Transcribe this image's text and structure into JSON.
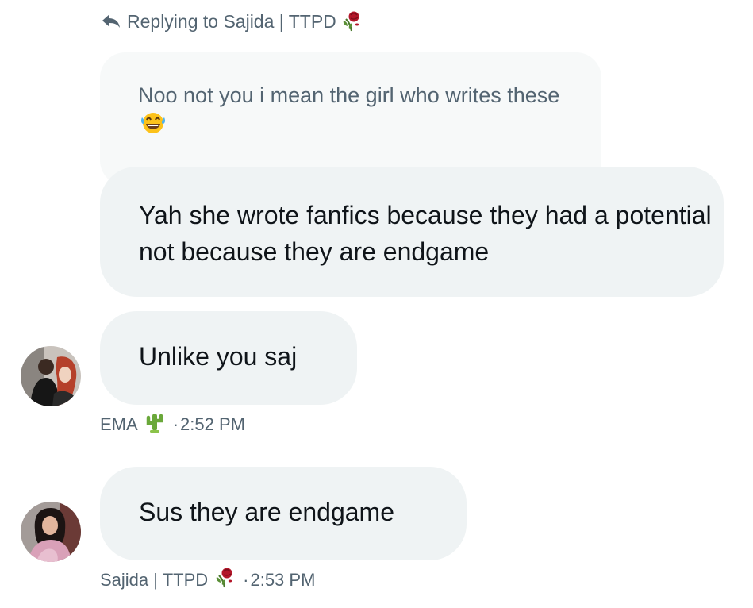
{
  "reply": {
    "text": "Replying to Sajida | TTPD",
    "icon": "reply-arrow-icon",
    "emoji": "wilted-rose-icon"
  },
  "quoted": {
    "text": "Noo not you i mean the girl who writes these",
    "emoji": "tears-of-joy-icon"
  },
  "messages": [
    {
      "text": "Yah she wrote fanfics because they had a potential not because they are endgame"
    },
    {
      "text": "Unlike you saj"
    },
    {
      "text": "Sus they are endgame"
    }
  ],
  "meta": [
    {
      "sender": "EMA",
      "emoji": "cactus-icon",
      "dot": "·",
      "time": "2:52 PM"
    },
    {
      "sender": "Sajida | TTPD",
      "emoji": "wilted-rose-icon",
      "dot": "·",
      "time": "2:53 PM"
    }
  ],
  "colors": {
    "secondary_text": "#536471",
    "primary_text": "#0f1419",
    "bubble": "#eff3f4",
    "quoted_bubble": "#f7f9f9"
  }
}
